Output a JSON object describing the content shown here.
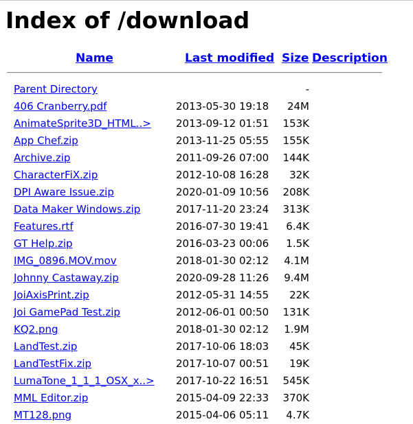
{
  "page": {
    "title": "Index of /download"
  },
  "table": {
    "headers": {
      "name": "Name",
      "last_modified": "Last modified",
      "size": "Size",
      "description": "Description"
    },
    "rows": [
      {
        "name": "Parent Directory",
        "modified": "",
        "size": "-"
      },
      {
        "name": "406 Cranberry.pdf",
        "modified": "2013-05-30 19:18",
        "size": "24M"
      },
      {
        "name": "AnimateSprite3D_HTML..>",
        "modified": "2013-09-12 01:51",
        "size": "153K"
      },
      {
        "name": "App Chef.zip",
        "modified": "2013-11-25 05:55",
        "size": "155K"
      },
      {
        "name": "Archive.zip",
        "modified": "2011-09-26 07:00",
        "size": "144K"
      },
      {
        "name": "CharacterFiX.zip",
        "modified": "2012-10-08 16:28",
        "size": "32K"
      },
      {
        "name": "DPI Aware Issue.zip",
        "modified": "2020-01-09 10:56",
        "size": "208K"
      },
      {
        "name": "Data Maker Windows.zip",
        "modified": "2017-11-20 23:24",
        "size": "313K"
      },
      {
        "name": "Features.rtf",
        "modified": "2016-07-30 19:41",
        "size": "6.4K"
      },
      {
        "name": "GT Help.zip",
        "modified": "2016-03-23 00:06",
        "size": "1.5K"
      },
      {
        "name": "IMG_0896.MOV.mov",
        "modified": "2018-01-30 02:12",
        "size": "4.1M"
      },
      {
        "name": "Johnny Castaway.zip",
        "modified": "2020-09-28 11:26",
        "size": "9.4M"
      },
      {
        "name": "JoiAxisPrint.zip",
        "modified": "2012-05-31 14:55",
        "size": "22K"
      },
      {
        "name": "Joi GamePad Test.zip",
        "modified": "2012-06-01 00:50",
        "size": "131K"
      },
      {
        "name": "KQ2.png",
        "modified": "2018-01-30 02:12",
        "size": "1.9M"
      },
      {
        "name": "LandTest.zip",
        "modified": "2017-10-06 18:03",
        "size": "45K"
      },
      {
        "name": "LandTestFix.zip",
        "modified": "2017-10-07 00:51",
        "size": "19K"
      },
      {
        "name": "LumaTone_1_1_1_OSX_x..>",
        "modified": "2017-10-22 16:51",
        "size": "545K"
      },
      {
        "name": "MML Editor.zip",
        "modified": "2015-04-09 22:33",
        "size": "370K"
      },
      {
        "name": "MT128.png",
        "modified": "2015-04-06 05:11",
        "size": "4.7K"
      }
    ]
  }
}
